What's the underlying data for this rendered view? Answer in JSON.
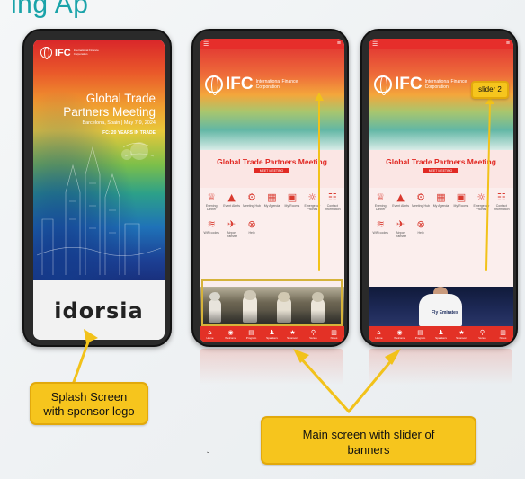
{
  "slide": {
    "title": "ing Ap"
  },
  "splash": {
    "ifc_logo_text": "IFC",
    "ifc_logo_sub": "International Finance Corporation",
    "title_line1": "Global Trade",
    "title_line2": "Partners Meeting",
    "subtitle": "Barcelona, Spain | May 7-9, 2024",
    "subtitle2": "IFC: 20 YEARS IN TRADE",
    "sponsor_logo": "idorsia"
  },
  "main_screen": {
    "ifc_logo_text": "IFC",
    "ifc_logo_sub": "International Finance Corporation",
    "event_title": "Global Trade Partners Meeting",
    "event_badge": "MEET MEETING",
    "grid_items": [
      {
        "icon": "trophy-icon",
        "glyph": "♕",
        "label": "Evening Dinner"
      },
      {
        "icon": "event-alerts-icon",
        "glyph": "▲",
        "label": "Event Alerts"
      },
      {
        "icon": "meeting-hub-icon",
        "glyph": "⚙",
        "label": "Meeting Hub"
      },
      {
        "icon": "agenda-icon",
        "glyph": "▦",
        "label": "My Agenda"
      },
      {
        "icon": "my-rooms-icon",
        "glyph": "▣",
        "label": "My Rooms"
      },
      {
        "icon": "emergency-icon",
        "glyph": "☼",
        "label": "Emergency Phones"
      },
      {
        "icon": "contact-icon",
        "glyph": "☷",
        "label": "Contact Information"
      },
      {
        "icon": "wifi-icon",
        "glyph": "≋",
        "label": "WiFi codes"
      },
      {
        "icon": "airplane-icon",
        "glyph": "✈",
        "label": "Airport Transfer"
      },
      {
        "icon": "help-icon",
        "glyph": "⊗",
        "label": "Help"
      }
    ],
    "nav_items": [
      {
        "icon": "home-icon",
        "glyph": "⌂",
        "label": "Home"
      },
      {
        "icon": "welcome-icon",
        "glyph": "◉",
        "label": "Welcome"
      },
      {
        "icon": "program-icon",
        "glyph": "▤",
        "label": "Program"
      },
      {
        "icon": "speakers-icon",
        "glyph": "♟",
        "label": "Speakers"
      },
      {
        "icon": "sponsors-icon",
        "glyph": "★",
        "label": "Sponsors"
      },
      {
        "icon": "venue-icon",
        "glyph": "⚲",
        "label": "Venue"
      },
      {
        "icon": "notes-icon",
        "glyph": "▥",
        "label": "Notes"
      }
    ],
    "jersey_text": "Fly Emirates"
  },
  "annotations": {
    "splash_callout_line1": "Splash Screen",
    "splash_callout_line2": "with sponsor logo",
    "main_callout_line1": "Main screen with slider of",
    "main_callout_line2": "banners",
    "slider2_label": "slider 2"
  },
  "colors": {
    "accent_red": "#e62e2b",
    "callout_yellow": "#f6c51d",
    "title_teal": "#1aa3a9"
  }
}
